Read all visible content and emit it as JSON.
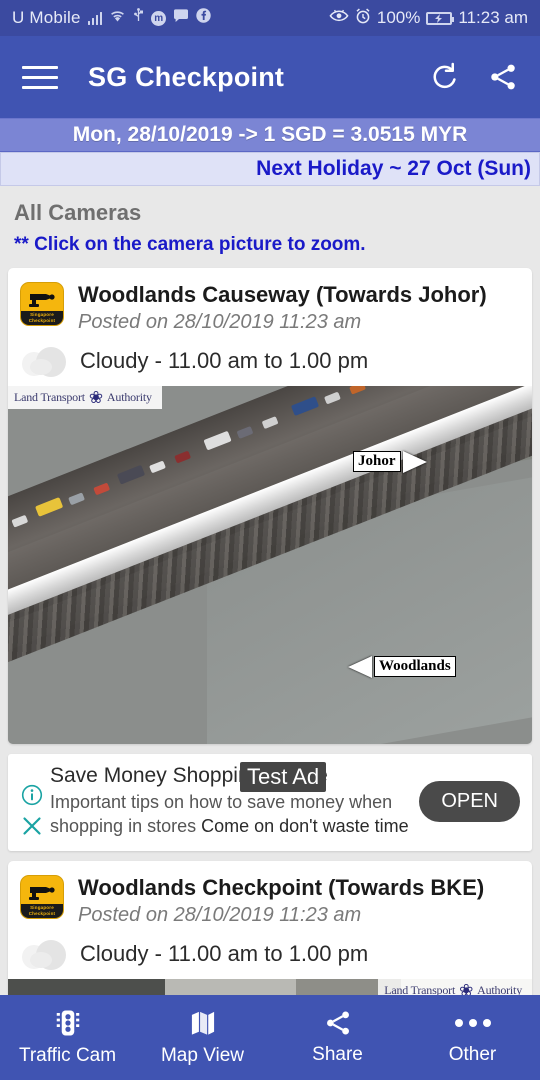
{
  "status_bar": {
    "carrier": "U Mobile",
    "battery_percent": "100%",
    "time": "11:23 am",
    "icons": [
      "signal-icon",
      "wifi-icon",
      "usb-icon",
      "mi-badge-icon",
      "message-icon",
      "facebook-icon",
      "eye-care-icon",
      "alarm-icon",
      "battery-charging-icon"
    ]
  },
  "app_bar": {
    "title": "SG Checkpoint",
    "menu_label": "Menu",
    "refresh_label": "Refresh",
    "share_label": "Share",
    "background": "#4054b2"
  },
  "rate_bar": {
    "text": "Mon, 28/10/2019 -> 1 SGD = 3.0515 MYR",
    "background": "#7b85d4"
  },
  "holiday_bar": {
    "text": "Next Holiday ~ 27 Oct (Sun)",
    "color": "#1a1ac8"
  },
  "content": {
    "section_title": "All Cameras",
    "hint": "** Click on the camera picture to zoom."
  },
  "cameras": [
    {
      "name": "Woodlands Causeway (Towards Johor)",
      "posted": "Posted on 28/10/2019 11:23 am",
      "weather": "Cloudy - 11.00 am to 1.00 pm",
      "watermark": "Land Transport",
      "watermark2": "Authority",
      "direction_far": "Johor",
      "direction_near": "Woodlands"
    },
    {
      "name": "Woodlands Checkpoint (Towards BKE)",
      "posted": "Posted on 28/10/2019 11:23 am",
      "weather": "Cloudy - 11.00 am to 1.00 pm",
      "watermark": "Land Transport",
      "watermark2": "Authority"
    }
  ],
  "ad": {
    "badge": "Test Ad",
    "title": "Save Money Shopping Online",
    "description": "Important tips on how to save money when shopping in stores",
    "description_tail": "Come on don't waste time",
    "button": "OPEN"
  },
  "bottom_nav": [
    {
      "label": "Traffic Cam",
      "icon": "traffic-light-icon"
    },
    {
      "label": "Map View",
      "icon": "map-icon"
    },
    {
      "label": "Share",
      "icon": "share-icon"
    },
    {
      "label": "Other",
      "icon": "more-dots-icon"
    }
  ]
}
